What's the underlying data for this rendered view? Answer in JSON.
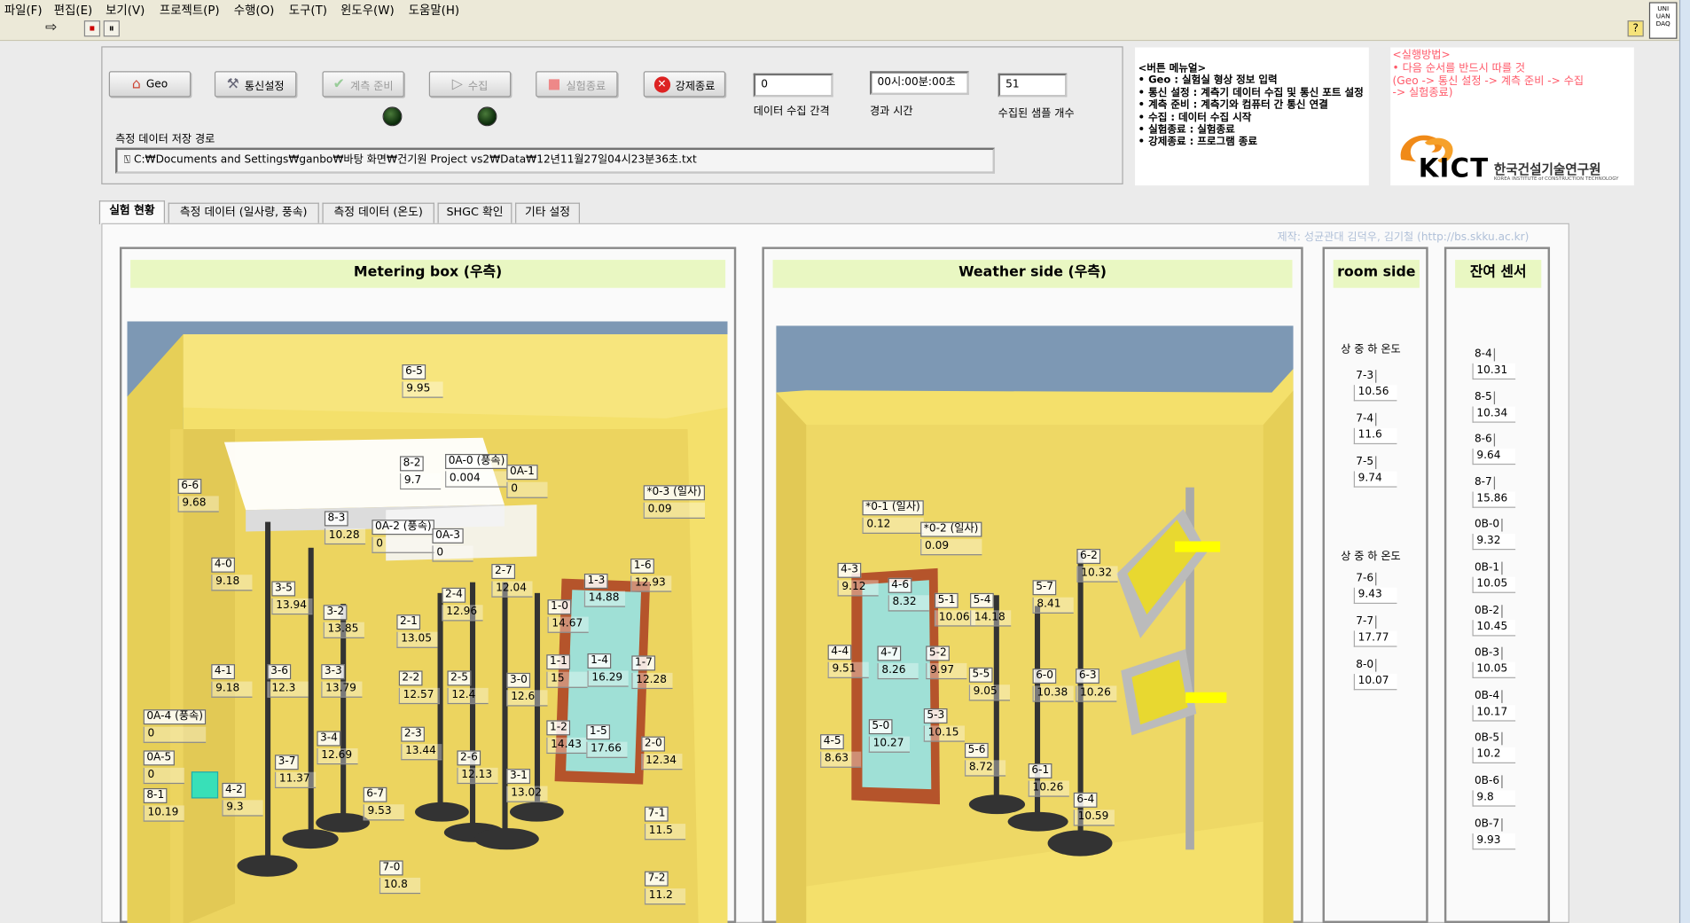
{
  "menu": [
    "파일(F)",
    "편집(E)",
    "보기(V)",
    "프로젝트(P)",
    "수행(O)",
    "도구(T)",
    "윈도우(W)",
    "도움말(H)"
  ],
  "toolbar": {
    "run_arrow": "⇨",
    "stop": "⏹",
    "pause": "⏸",
    "help": "?",
    "daq_badge": "UNI\nUAN\nDAQ"
  },
  "buttons": {
    "geo": "Geo",
    "comm": "통신설정",
    "ready": "계측 준비",
    "collect": "수집",
    "end": "실험종료",
    "force_end": "강제종료"
  },
  "fields": {
    "interval": {
      "value": "0",
      "label": "데이터 수집 간격"
    },
    "elapsed": {
      "value": "00시:00분:00초",
      "label": "경과 시간"
    },
    "samples": {
      "value": "51",
      "label": "수집된 샘플 개수"
    }
  },
  "path": {
    "label": "측정 데이터 저장 경로",
    "value": "C:₩Documents and Settings₩ganbo₩바탕 화면₩건기원 Project vs2₩Data₩12년11월27일04시23분36초.txt"
  },
  "manual": {
    "title": "<버튼 메뉴얼>",
    "lines": [
      "• Geo : 실험실 형상 정보 입력",
      "• 통신 설정 : 계측기 데이터 수집 및 통신 포트 설정",
      "• 계측 준비 : 계측기와 컴퓨터 간 통신 연결",
      "• 수집 : 데이터 수집 시작",
      "• 실험종료 : 실험종료",
      "• 강제종료 : 프로그램 종료"
    ]
  },
  "method": {
    "lines": [
      "<실행방법>",
      "• 다음 순서를 반드시 따를 것",
      "(Geo -> 통신 설정 -> 계측 준비 -> 수집",
      "-> 실험종료)"
    ]
  },
  "logo": {
    "abbr": "KICT",
    "name_kr": "한국건설기술연구원",
    "name_en": "KOREA INSTITUTE of CONSTRUCTION TECHNOLOGY"
  },
  "tabs": [
    "실험 현황",
    "측정 데이터 (일사량, 풍속)",
    "측정 데이터 (온도)",
    "SHGC 확인",
    "기타 설정"
  ],
  "credit": "제작: 성균관대 김덕우, 김기철 (http://bs.skku.ac.kr)",
  "panels": {
    "metering": "Metering box (우측)",
    "weather": "Weather side (우측)",
    "room": "room side",
    "rest": "잔여 센서"
  },
  "metering_sensors": [
    {
      "n": "6-5",
      "v": "9.95"
    },
    {
      "n": "8-2",
      "v": "9.7"
    },
    {
      "n": "0A-0 (풍속)",
      "v": "0.004"
    },
    {
      "n": "0A-1",
      "v": "0"
    },
    {
      "n": "6-6",
      "v": "9.68"
    },
    {
      "n": "*0-3 (일사)",
      "v": "0.09"
    },
    {
      "n": "8-3",
      "v": "10.28"
    },
    {
      "n": "0A-2 (풍속)",
      "v": "0"
    },
    {
      "n": "0A-3",
      "v": "0"
    },
    {
      "n": "4-0",
      "v": "9.18"
    },
    {
      "n": "2-7",
      "v": "12.04"
    },
    {
      "n": "1-6",
      "v": "12.93"
    },
    {
      "n": "3-5",
      "v": "13.94"
    },
    {
      "n": "1-3",
      "v": "14.88"
    },
    {
      "n": "2-4",
      "v": "12.96"
    },
    {
      "n": "3-2",
      "v": "13.85"
    },
    {
      "n": "1-0",
      "v": "14.67"
    },
    {
      "n": "2-1",
      "v": "13.05"
    },
    {
      "n": "4-1",
      "v": "9.18"
    },
    {
      "n": "3-6",
      "v": "12.3"
    },
    {
      "n": "3-3",
      "v": "13.79"
    },
    {
      "n": "2-2",
      "v": "12.57"
    },
    {
      "n": "2-5",
      "v": "12.4"
    },
    {
      "n": "3-0",
      "v": "12.6"
    },
    {
      "n": "1-1",
      "v": "15"
    },
    {
      "n": "1-4",
      "v": "16.29"
    },
    {
      "n": "1-7",
      "v": "12.28"
    },
    {
      "n": "0A-4 (풍속)",
      "v": "0"
    },
    {
      "n": "3-4",
      "v": "12.69"
    },
    {
      "n": "2-3",
      "v": "13.44"
    },
    {
      "n": "1-2",
      "v": "14.43"
    },
    {
      "n": "1-5",
      "v": "17.66"
    },
    {
      "n": "2-0",
      "v": "12.34"
    },
    {
      "n": "0A-5",
      "v": "0"
    },
    {
      "n": "3-7",
      "v": "11.37"
    },
    {
      "n": "2-6",
      "v": "12.13"
    },
    {
      "n": "3-1",
      "v": "13.02"
    },
    {
      "n": "8-1",
      "v": "10.19"
    },
    {
      "n": "4-2",
      "v": "9.3"
    },
    {
      "n": "6-7",
      "v": "9.53"
    },
    {
      "n": "7-1",
      "v": "11.5"
    },
    {
      "n": "7-0",
      "v": "10.8"
    },
    {
      "n": "7-2",
      "v": "11.2"
    }
  ],
  "weather_sensors": [
    {
      "n": "*0-1 (일사)",
      "v": "0.12"
    },
    {
      "n": "*0-2 (일사)",
      "v": "0.09"
    },
    {
      "n": "6-2",
      "v": "10.32"
    },
    {
      "n": "4-3",
      "v": "9.12"
    },
    {
      "n": "4-6",
      "v": "8.32"
    },
    {
      "n": "5-1",
      "v": "10.06"
    },
    {
      "n": "5-4",
      "v": "14.18"
    },
    {
      "n": "5-7",
      "v": "8.41"
    },
    {
      "n": "4-4",
      "v": "9.51"
    },
    {
      "n": "4-7",
      "v": "8.26"
    },
    {
      "n": "5-2",
      "v": "9.97"
    },
    {
      "n": "5-5",
      "v": "9.05"
    },
    {
      "n": "6-0",
      "v": "10.38"
    },
    {
      "n": "6-3",
      "v": "10.26"
    },
    {
      "n": "5-0",
      "v": "10.27"
    },
    {
      "n": "5-3",
      "v": "10.15"
    },
    {
      "n": "4-5",
      "v": "8.63"
    },
    {
      "n": "5-6",
      "v": "8.72"
    },
    {
      "n": "6-1",
      "v": "10.26"
    },
    {
      "n": "6-4",
      "v": "10.59"
    }
  ],
  "room": {
    "group1_label": "상 중 하 온도",
    "group1": [
      {
        "n": "7-3",
        "v": "10.56"
      },
      {
        "n": "7-4",
        "v": "11.6"
      },
      {
        "n": "7-5",
        "v": "9.74"
      }
    ],
    "group2_label": "상 중 하 온도",
    "group2": [
      {
        "n": "7-6",
        "v": "9.43"
      },
      {
        "n": "7-7",
        "v": "17.77"
      },
      {
        "n": "8-0",
        "v": "10.07"
      }
    ]
  },
  "rest": [
    {
      "n": "8-4",
      "v": "10.31"
    },
    {
      "n": "8-5",
      "v": "10.34"
    },
    {
      "n": "8-6",
      "v": "9.64"
    },
    {
      "n": "8-7",
      "v": "15.86"
    },
    {
      "n": "0B-0",
      "v": "9.32"
    },
    {
      "n": "0B-1",
      "v": "10.05"
    },
    {
      "n": "0B-2",
      "v": "10.45"
    },
    {
      "n": "0B-3",
      "v": "10.05"
    },
    {
      "n": "0B-4",
      "v": "10.17"
    },
    {
      "n": "0B-5",
      "v": "10.2"
    },
    {
      "n": "0B-6",
      "v": "9.8"
    },
    {
      "n": "0B-7",
      "v": "9.93"
    }
  ],
  "colors": {
    "wall": "#f4e06b",
    "sky": "#7d98b4",
    "panel_head": "#e9f7c2",
    "glass": "#9fe0d6",
    "frame": "#b5542b",
    "led": "#1d4a15"
  }
}
